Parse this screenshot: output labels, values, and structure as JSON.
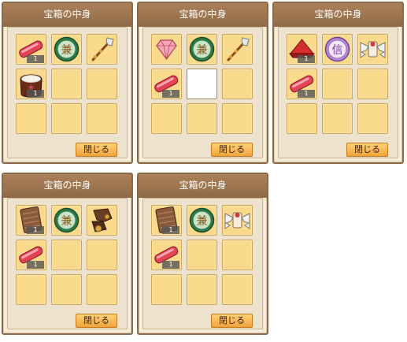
{
  "panel_title": "宝箱の中身",
  "close_label": "閉じる",
  "quantity": "1",
  "panels": [
    {
      "slots": [
        {
          "icon": "red-crystal-bar-icon",
          "qty": "1"
        },
        {
          "icon": "green-coin-icon"
        },
        {
          "icon": "feathered-staff-icon"
        },
        {
          "icon": "rice-bag-icon",
          "qty": "1"
        },
        {},
        {},
        {},
        {},
        {}
      ]
    },
    {
      "slots": [
        {
          "icon": "pink-diamond-icon"
        },
        {
          "icon": "green-coin-icon"
        },
        {
          "icon": "feathered-staff-icon"
        },
        {
          "icon": "red-crystal-bar-icon",
          "qty": "1"
        },
        {
          "selected": true
        },
        {},
        {},
        {},
        {}
      ]
    },
    {
      "slots": [
        {
          "icon": "red-hat-icon",
          "qty": "1"
        },
        {
          "icon": "purple-coin-icon"
        },
        {
          "icon": "winged-scroll-icon"
        },
        {
          "icon": "red-crystal-bar-icon",
          "qty": "1"
        },
        {},
        {},
        {},
        {},
        {}
      ]
    },
    {
      "slots": [
        {
          "icon": "leather-armor-icon",
          "qty": "1"
        },
        {
          "icon": "green-coin-icon"
        },
        {
          "icon": "leather-gloves-icon"
        },
        {
          "icon": "red-crystal-bar-icon",
          "qty": "1"
        },
        {},
        {},
        {},
        {},
        {}
      ]
    },
    {
      "slots": [
        {
          "icon": "leather-armor-icon",
          "qty": "1"
        },
        {
          "icon": "green-coin-icon"
        },
        {
          "icon": "winged-scroll-icon"
        },
        {
          "icon": "red-crystal-bar-icon",
          "qty": "1"
        },
        {},
        {},
        {},
        {},
        {}
      ]
    }
  ]
}
